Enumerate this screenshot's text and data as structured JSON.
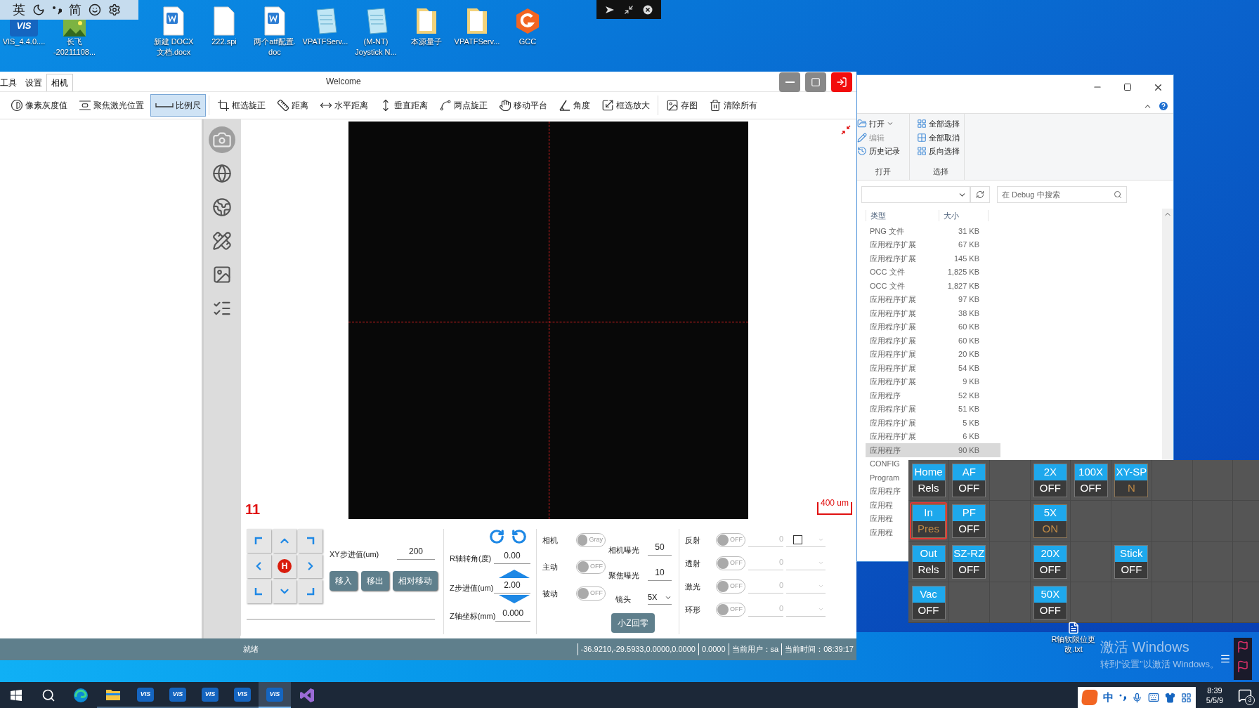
{
  "ime_bar": {
    "labels": [
      "英",
      "简"
    ]
  },
  "desktop_icons": [
    {
      "kind": "vis",
      "badge": "VIS",
      "lines": [
        "VIS_4.4.0...."
      ]
    },
    {
      "kind": "image",
      "lines": [
        "长飞",
        "-20211108..."
      ]
    },
    {
      "kind": "word",
      "lines": [
        "新建 DOCX",
        "文档.docx"
      ]
    },
    {
      "kind": "file",
      "lines": [
        "222.spi"
      ]
    },
    {
      "kind": "word",
      "lines": [
        "两个atf配置.",
        "doc"
      ]
    },
    {
      "kind": "notepad",
      "lines": [
        "VPATFServ..."
      ]
    },
    {
      "kind": "notepad",
      "lines": [
        "(M-NT)",
        "Joystick N..."
      ]
    },
    {
      "kind": "folder",
      "lines": [
        "本源量子"
      ]
    },
    {
      "kind": "folder",
      "lines": [
        "VPATFServ..."
      ]
    },
    {
      "kind": "gcc",
      "lines": [
        "GCC"
      ]
    }
  ],
  "app": {
    "title": "Welcome",
    "menu": [
      {
        "label": "工具",
        "selected": false
      },
      {
        "label": "设置",
        "selected": false
      },
      {
        "label": "相机",
        "selected": true
      }
    ],
    "toolbar": [
      {
        "kind": "contrast",
        "label": "像素灰度值",
        "selected": false
      },
      {
        "kind": "focus",
        "label": "聚焦激光位置",
        "selected": false
      },
      {
        "kind": "scale",
        "label": "比例尺",
        "selected": true
      },
      {
        "kind": "rotate",
        "label": "框选旋正",
        "selected": false
      },
      {
        "kind": "ruler",
        "label": "距离",
        "selected": false
      },
      {
        "kind": "hdist",
        "label": "水平距离",
        "selected": false
      },
      {
        "kind": "vdist",
        "label": "垂直距离",
        "selected": false
      },
      {
        "kind": "twopoint",
        "label": "两点旋正",
        "selected": false
      },
      {
        "kind": "hand",
        "label": "移动平台",
        "selected": false
      },
      {
        "kind": "angle",
        "label": "角度",
        "selected": false
      },
      {
        "kind": "zoombox",
        "label": "框选放大",
        "selected": false
      },
      {
        "kind": "image",
        "label": "存图",
        "selected": false
      },
      {
        "kind": "trash",
        "label": "清除所有",
        "selected": false
      }
    ],
    "canvas": {
      "index_label": "11",
      "scale_label": "400 um"
    },
    "controls": {
      "home_label": "H",
      "xy_step": {
        "label": "XY步进值(um)",
        "value": "200"
      },
      "move_buttons": [
        "移入",
        "移出",
        "相对移动"
      ],
      "r_angle": {
        "label": "R轴转角(度)",
        "value": "0.00"
      },
      "z_step": {
        "label": "Z步进值(um)",
        "value": "2.00"
      },
      "z_coord": {
        "label": "Z轴坐标(mm)",
        "value": "0.000"
      },
      "modes": [
        {
          "label": "相机",
          "toggle": "Gray",
          "on": false
        },
        {
          "label": "主动",
          "toggle": "OFF",
          "on": false
        },
        {
          "label": "被动",
          "toggle": "OFF",
          "on": false
        }
      ],
      "exposure": [
        {
          "label": "相机曝光",
          "value": "50"
        },
        {
          "label": "聚焦曝光",
          "value": "10"
        }
      ],
      "lens": {
        "label": "镜头",
        "value": "5X"
      },
      "z_zero_button": "小Z回零",
      "lights": [
        {
          "label": "反射",
          "toggle": "OFF",
          "on": false,
          "value": "0"
        },
        {
          "label": "透射",
          "toggle": "OFF",
          "on": false,
          "value": "0"
        },
        {
          "label": "激光",
          "toggle": "OFF",
          "on": false,
          "value": "0"
        },
        {
          "label": "环形",
          "toggle": "OFF",
          "on": false,
          "value": "0"
        }
      ],
      "reflect_checkbox": {
        "checked": false
      }
    },
    "status_bar": [
      "就绪",
      "-36.9210,-29.5933,0.0000,0.0000",
      "0.0000",
      "当前用户：sa",
      "当前时间：08:39:17"
    ]
  },
  "explorer": {
    "ribbon": [
      {
        "label": "打开",
        "items": [
          {
            "label": "打开",
            "kind": "open",
            "disabled": false
          },
          {
            "label": "编辑",
            "kind": "edit",
            "disabled": true
          },
          {
            "label": "历史记录",
            "kind": "history",
            "disabled": false
          }
        ]
      },
      {
        "label": "选择",
        "items": [
          {
            "label": "全部选择",
            "kind": "selectall",
            "disabled": false
          },
          {
            "label": "全部取消",
            "kind": "selectnone",
            "disabled": false
          },
          {
            "label": "反向选择",
            "kind": "invert",
            "disabled": false
          }
        ]
      }
    ],
    "search": {
      "placeholder": "在 Debug 中搜索"
    },
    "columns": [
      "类型",
      "大小"
    ],
    "rows": [
      {
        "type": "PNG 文件",
        "size": "31 KB",
        "selected": false
      },
      {
        "type": "应用程序扩展",
        "size": "67 KB",
        "selected": false
      },
      {
        "type": "应用程序扩展",
        "size": "145 KB",
        "selected": false
      },
      {
        "type": "OCC 文件",
        "size": "1,825 KB",
        "selected": false
      },
      {
        "type": "OCC 文件",
        "size": "1,827 KB",
        "selected": false
      },
      {
        "type": "应用程序扩展",
        "size": "97 KB",
        "selected": false
      },
      {
        "type": "应用程序扩展",
        "size": "38 KB",
        "selected": false
      },
      {
        "type": "应用程序扩展",
        "size": "60 KB",
        "selected": false
      },
      {
        "type": "应用程序扩展",
        "size": "60 KB",
        "selected": false
      },
      {
        "type": "应用程序扩展",
        "size": "20 KB",
        "selected": false
      },
      {
        "type": "应用程序扩展",
        "size": "54 KB",
        "selected": false
      },
      {
        "type": "应用程序扩展",
        "size": "9 KB",
        "selected": false
      },
      {
        "type": "应用程序",
        "size": "52 KB",
        "selected": false
      },
      {
        "type": "应用程序扩展",
        "size": "51 KB",
        "selected": false
      },
      {
        "type": "应用程序扩展",
        "size": "5 KB",
        "selected": false
      },
      {
        "type": "应用程序扩展",
        "size": "6 KB",
        "selected": false
      },
      {
        "type": "应用程序",
        "size": "90 KB",
        "selected": true
      },
      {
        "type": "CONFIG",
        "selected": false
      },
      {
        "type": "Program",
        "selected": false
      },
      {
        "type": "应用程序",
        "selected": false
      },
      {
        "type": "应用程",
        "selected": false
      },
      {
        "type": "应用程",
        "selected": false
      },
      {
        "type": "应用程",
        "selected": false
      }
    ]
  },
  "control_grid": {
    "rows": [
      {
        "cells": [
          {
            "kind": "button",
            "label": "Home",
            "state": "Rels",
            "active": false,
            "highlighted": false
          },
          {
            "kind": "button",
            "label": "AF",
            "state": "OFF",
            "active": false,
            "highlighted": false
          },
          {
            "kind": "empty"
          },
          {
            "kind": "button",
            "label": "2X",
            "state": "OFF",
            "active": false,
            "highlighted": false
          },
          {
            "kind": "button",
            "label": "100X",
            "state": "OFF",
            "active": false,
            "highlighted": false
          },
          {
            "kind": "button",
            "label": "XY-SP",
            "state": "N",
            "active": true,
            "highlighted": false
          },
          {
            "kind": "empty"
          },
          {
            "kind": "empty"
          },
          {
            "kind": "empty"
          }
        ]
      },
      {
        "cells": [
          {
            "kind": "button",
            "label": "In",
            "state": "Pres",
            "active": true,
            "highlighted": true
          },
          {
            "kind": "button",
            "label": "PF",
            "state": "OFF",
            "active": false,
            "highlighted": false
          },
          {
            "kind": "empty"
          },
          {
            "kind": "button",
            "label": "5X",
            "state": "ON",
            "active": true,
            "highlighted": false
          },
          {
            "kind": "empty"
          },
          {
            "kind": "empty"
          },
          {
            "kind": "empty"
          },
          {
            "kind": "empty"
          },
          {
            "kind": "empty"
          }
        ]
      },
      {
        "cells": [
          {
            "kind": "button",
            "label": "Out",
            "state": "Rels",
            "active": false,
            "highlighted": false
          },
          {
            "kind": "button",
            "label": "SZ-RZ",
            "state": "OFF",
            "active": false,
            "highlighted": false
          },
          {
            "kind": "empty"
          },
          {
            "kind": "button",
            "label": "20X",
            "state": "OFF",
            "active": false,
            "highlighted": false
          },
          {
            "kind": "empty"
          },
          {
            "kind": "button",
            "label": "Stick",
            "state": "OFF",
            "active": false,
            "highlighted": false
          },
          {
            "kind": "empty"
          },
          {
            "kind": "empty"
          },
          {
            "kind": "empty"
          }
        ]
      },
      {
        "cells": [
          {
            "kind": "button",
            "label": "Vac",
            "state": "OFF",
            "active": false,
            "highlighted": false
          },
          {
            "kind": "empty"
          },
          {
            "kind": "empty"
          },
          {
            "kind": "button",
            "label": "50X",
            "state": "OFF",
            "active": false,
            "highlighted": false
          },
          {
            "kind": "empty"
          },
          {
            "kind": "empty"
          },
          {
            "kind": "empty"
          },
          {
            "kind": "empty"
          },
          {
            "kind": "empty"
          }
        ]
      }
    ]
  },
  "desktop_file": {
    "lines": [
      "R轴软限位更",
      "改.txt"
    ]
  },
  "activation_notice": {
    "title": "激活 Windows",
    "subtitle": "转到“设置”以激活 Windows。"
  },
  "taskbar": {
    "apps": [
      {
        "kind": "start",
        "active": false
      },
      {
        "kind": "search",
        "active": false
      },
      {
        "kind": "edge",
        "active": false
      },
      {
        "kind": "explorer",
        "active": false
      },
      {
        "kind": "vis",
        "badge": "VIS",
        "active": false
      },
      {
        "kind": "vis",
        "badge": "VIS",
        "active": false
      },
      {
        "kind": "vis",
        "badge": "VIS",
        "active": false
      },
      {
        "kind": "vis",
        "badge": "VIS",
        "active": false
      },
      {
        "kind": "vis",
        "badge": "VIS",
        "active": true
      },
      {
        "kind": "studio",
        "active": false
      }
    ],
    "ime_mode": "中",
    "clock": [
      "8:39",
      "5/5/9"
    ],
    "notifications": "3"
  }
}
